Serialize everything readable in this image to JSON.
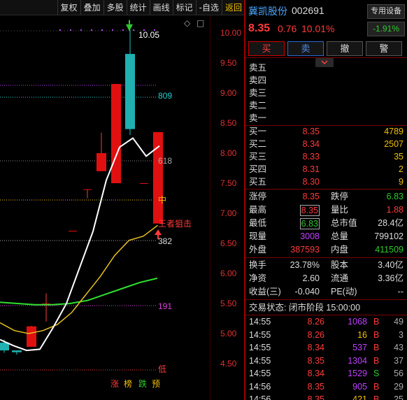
{
  "toolbar": {
    "items": [
      "复权",
      "叠加",
      "多股",
      "统计",
      "画线",
      "标记",
      "-自选",
      "返回"
    ]
  },
  "colors": {
    "up": "#ff3a3a",
    "down": "#2ec82e",
    "bull_candle": "#e01010",
    "bear_candle": "#20b0b0",
    "ma_fast": "#ffffff",
    "ma_mid": "#e6c020",
    "ma_slow": "#30e030",
    "level_label": "#20d0d0",
    "axis_text": "#e03030"
  },
  "chart": {
    "high_label": "10.05",
    "level_809": "809",
    "level_618": "618",
    "level_mid": "中",
    "level_382": "382",
    "level_191": "191",
    "low_label": "低",
    "annotation": "王者狙击",
    "badges": [
      "涨",
      "榜",
      "跌",
      "预"
    ],
    "corner_marks": [
      "◇",
      "□"
    ],
    "y_axis": [
      "10.00",
      "9.50",
      "9.00",
      "8.50",
      "8.00",
      "7.50",
      "7.00",
      "6.50",
      "6.00",
      "5.50",
      "5.00",
      "4.50"
    ],
    "candles": [
      {
        "o": 4.85,
        "h": 4.9,
        "l": 4.68,
        "c": 4.72
      },
      {
        "o": 4.72,
        "h": 4.72,
        "l": 4.65,
        "c": 4.69
      },
      {
        "o": 4.78,
        "h": 5.13,
        "l": 4.78,
        "c": 5.12
      },
      {
        "o": 5.48,
        "h": 5.67,
        "l": 5.2,
        "c": 5.5
      },
      {
        "o": 6.71,
        "h": 6.71,
        "l": 6.7,
        "c": 6.71
      },
      {
        "o": 7.4,
        "h": 7.4,
        "l": 7.25,
        "c": 7.4
      },
      {
        "o": 7.7,
        "h": 8.34,
        "l": 7.7,
        "c": 8.0
      },
      {
        "o": 7.5,
        "h": 9.15,
        "l": 7.5,
        "c": 9.15
      },
      {
        "o": 9.65,
        "h": 10.05,
        "l": 8.3,
        "c": 8.4
      },
      {
        "o": 7.5,
        "h": 7.5,
        "l": 7.49,
        "c": 7.5
      },
      {
        "o": 6.83,
        "h": 8.35,
        "l": 6.83,
        "c": 8.35
      }
    ],
    "ma_fast": [
      4.9,
      4.8,
      4.72,
      4.74,
      5.1,
      5.5,
      6.1,
      6.7,
      7.55,
      8.1,
      8.25,
      7.95,
      8.12
    ],
    "ma_mid": [
      5.18,
      5.05,
      5.0,
      5.05,
      5.15,
      5.35,
      5.65,
      5.95,
      6.3,
      6.55,
      6.62,
      6.8
    ],
    "ma_slow": [
      5.52,
      5.5,
      5.48,
      5.48,
      5.5,
      5.55,
      5.65,
      5.75,
      5.85,
      5.92
    ]
  },
  "quote": {
    "name": "冀凯股份",
    "code": "002691",
    "device_btn": "专用设备",
    "device_pct": "-1.91%",
    "price": "8.35",
    "change": "0.76",
    "change_pct": "10.01%",
    "buttons": [
      "买",
      "卖",
      "撤",
      "警"
    ],
    "sell_levels": [
      "卖五",
      "卖四",
      "卖三",
      "卖二",
      "卖一"
    ],
    "buy_levels": [
      {
        "label": "买一",
        "price": "8.35",
        "vol": "4789"
      },
      {
        "label": "买二",
        "price": "8.34",
        "vol": "2507"
      },
      {
        "label": "买三",
        "price": "8.33",
        "vol": "35"
      },
      {
        "label": "买四",
        "price": "8.31",
        "vol": "2"
      },
      {
        "label": "买五",
        "price": "8.30",
        "vol": "9"
      }
    ],
    "stats": {
      "limit_up_l": "涨停",
      "limit_up": "8.35",
      "limit_down_l": "跌停",
      "limit_down": "6.83",
      "high_l": "最高",
      "high": "8.35",
      "vol_ratio_l": "量比",
      "vol_ratio": "1.88",
      "low_l": "最低",
      "low": "6.83",
      "mcap_l": "总市值",
      "mcap": "28.4亿",
      "cur_vol_l": "现量",
      "cur_vol": "3008",
      "total_vol_l": "总量",
      "total_vol": "799102",
      "outer_l": "外盘",
      "outer": "387593",
      "inner_l": "内盘",
      "inner": "411509",
      "turnover_l": "换手",
      "turnover": "23.78%",
      "equity_l": "股本",
      "equity": "3.40亿",
      "nav_l": "净资",
      "nav": "2.60",
      "float_l": "流通",
      "float": "3.36亿",
      "eps_l": "收益(三)",
      "eps": "-0.040",
      "pe_l": "PE(动)",
      "pe": "--"
    },
    "status": "交易状态: 闭市阶段 15:00:00",
    "ticks": [
      {
        "time": "14:55",
        "price": "8.26",
        "vol": "1068",
        "side": "B",
        "n": "49"
      },
      {
        "time": "14:55",
        "price": "8.26",
        "vol": "16",
        "side": "B",
        "n": "3"
      },
      {
        "time": "14:55",
        "price": "8.34",
        "vol": "537",
        "side": "B",
        "n": "43"
      },
      {
        "time": "14:55",
        "price": "8.35",
        "vol": "1304",
        "side": "B",
        "n": "37"
      },
      {
        "time": "14:55",
        "price": "8.34",
        "vol": "1529",
        "side": "S",
        "n": "56"
      },
      {
        "time": "14:56",
        "price": "8.35",
        "vol": "905",
        "side": "B",
        "n": "29"
      },
      {
        "time": "14:56",
        "price": "8.35",
        "vol": "421",
        "side": "B",
        "n": "25"
      }
    ]
  }
}
